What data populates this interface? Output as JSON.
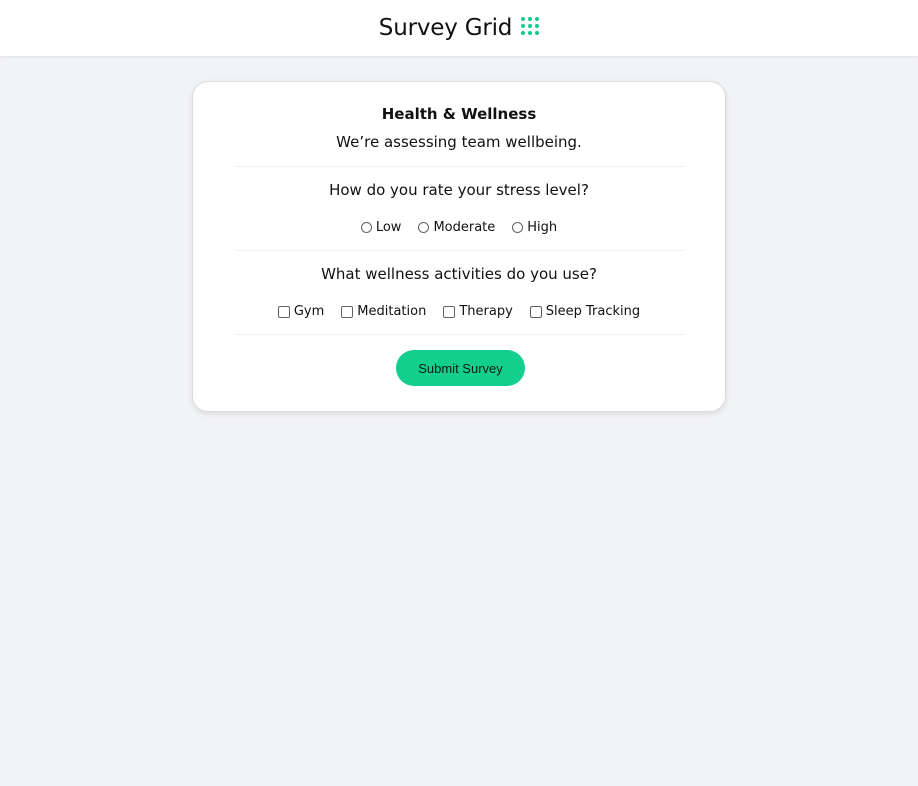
{
  "header": {
    "title": "Survey Grid",
    "icon": "grid-dots-icon",
    "icon_color": "#10c98b"
  },
  "survey": {
    "title": "Health & Wellness",
    "description": "We’re assessing team wellbeing.",
    "questions": [
      {
        "text": "How do you rate your stress level?",
        "type": "radio",
        "options": [
          "Low",
          "Moderate",
          "High"
        ]
      },
      {
        "text": "What wellness activities do you use?",
        "type": "checkbox",
        "options": [
          "Gym",
          "Meditation",
          "Therapy",
          "Sleep Tracking"
        ]
      }
    ],
    "submit_label": "Submit Survey",
    "accent_color": "#12cf8e"
  }
}
